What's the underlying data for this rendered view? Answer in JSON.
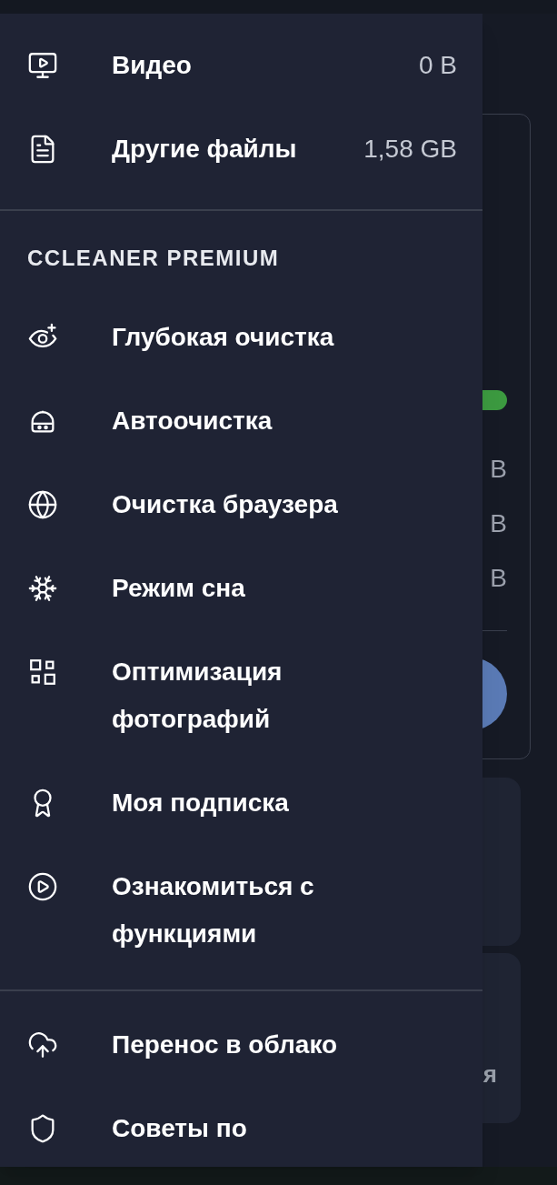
{
  "storage_items": [
    {
      "label": "Видео",
      "size": "0 B"
    },
    {
      "label": "Другие файлы",
      "size": "1,58 GB"
    }
  ],
  "premium_section": {
    "title": "CCLEANER PREMIUM",
    "items": [
      {
        "label": "Глубокая очистка"
      },
      {
        "label": "Автоочистка"
      },
      {
        "label": "Очистка браузера"
      },
      {
        "label": "Режим сна"
      },
      {
        "label": "Оптимизация фотографий"
      },
      {
        "label": "Моя подписка"
      },
      {
        "label": "Ознакомиться с функциями"
      }
    ]
  },
  "more_items": [
    {
      "label": "Перенос в облако"
    },
    {
      "label": "Советы по"
    }
  ],
  "background": {
    "card_values": [
      "B",
      "B",
      "B"
    ],
    "card_text": "я"
  }
}
